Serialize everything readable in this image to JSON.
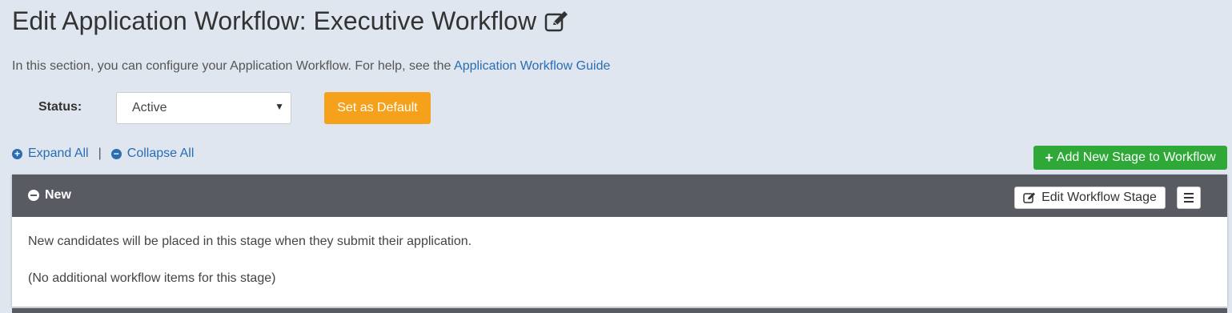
{
  "header": {
    "title": "Edit Application Workflow: Executive Workflow",
    "edit_icon": "pencil-square-icon"
  },
  "intro": {
    "text": "In this section, you can configure your Application Workflow. For help, see the",
    "link": "Application Workflow Guide"
  },
  "status": {
    "label": "Status:",
    "value": "Active",
    "default_button": "Set as Default"
  },
  "controls": {
    "expand_all": "Expand All",
    "separator": "|",
    "collapse_all": "Collapse All",
    "add_stage": "Add New Stage to Workflow"
  },
  "stage": {
    "name": "New",
    "edit_button": "Edit Workflow Stage",
    "description": "New candidates will be placed in this stage when they submit their application.",
    "items_note": "(No additional workflow items for this stage)"
  },
  "colors": {
    "background": "#dfe6ef",
    "link": "#2a6db3",
    "orange_button": "#f5a11c",
    "green_button": "#2ea836",
    "stage_header": "#585c62"
  }
}
